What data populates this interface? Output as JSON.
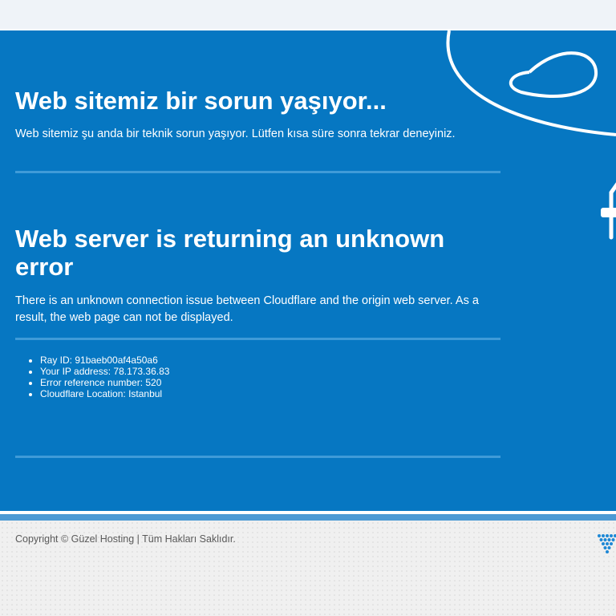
{
  "turkish_section": {
    "title": "Web sitemiz bir sorun yaşıyor...",
    "message": "Web sitemiz şu anda bir teknik sorun yaşıyor. Lütfen kısa süre sonra tekrar deneyiniz."
  },
  "error_section": {
    "title": "Web server is returning an unknown error",
    "message": "There is an unknown connection issue between Cloudflare and the origin web server. As a result, the web page can not be displayed."
  },
  "details": [
    "Ray ID: 91baeb00af4a50a6",
    "Your IP address: 78.173.36.83",
    "Error reference number: 520",
    "Cloudflare Location: Istanbul"
  ],
  "footer": {
    "copyright": "Copyright © Güzel Hosting | Tüm Hakları Saklıdır."
  },
  "colors": {
    "hero_background": "#0677c2",
    "rule": "#3f9bd8",
    "footer_background": "#f0f0f0",
    "logo": "#1e88d6"
  },
  "icons": [
    "decorative-cable-icon",
    "plug-icon",
    "hosting-logo-icon"
  ]
}
